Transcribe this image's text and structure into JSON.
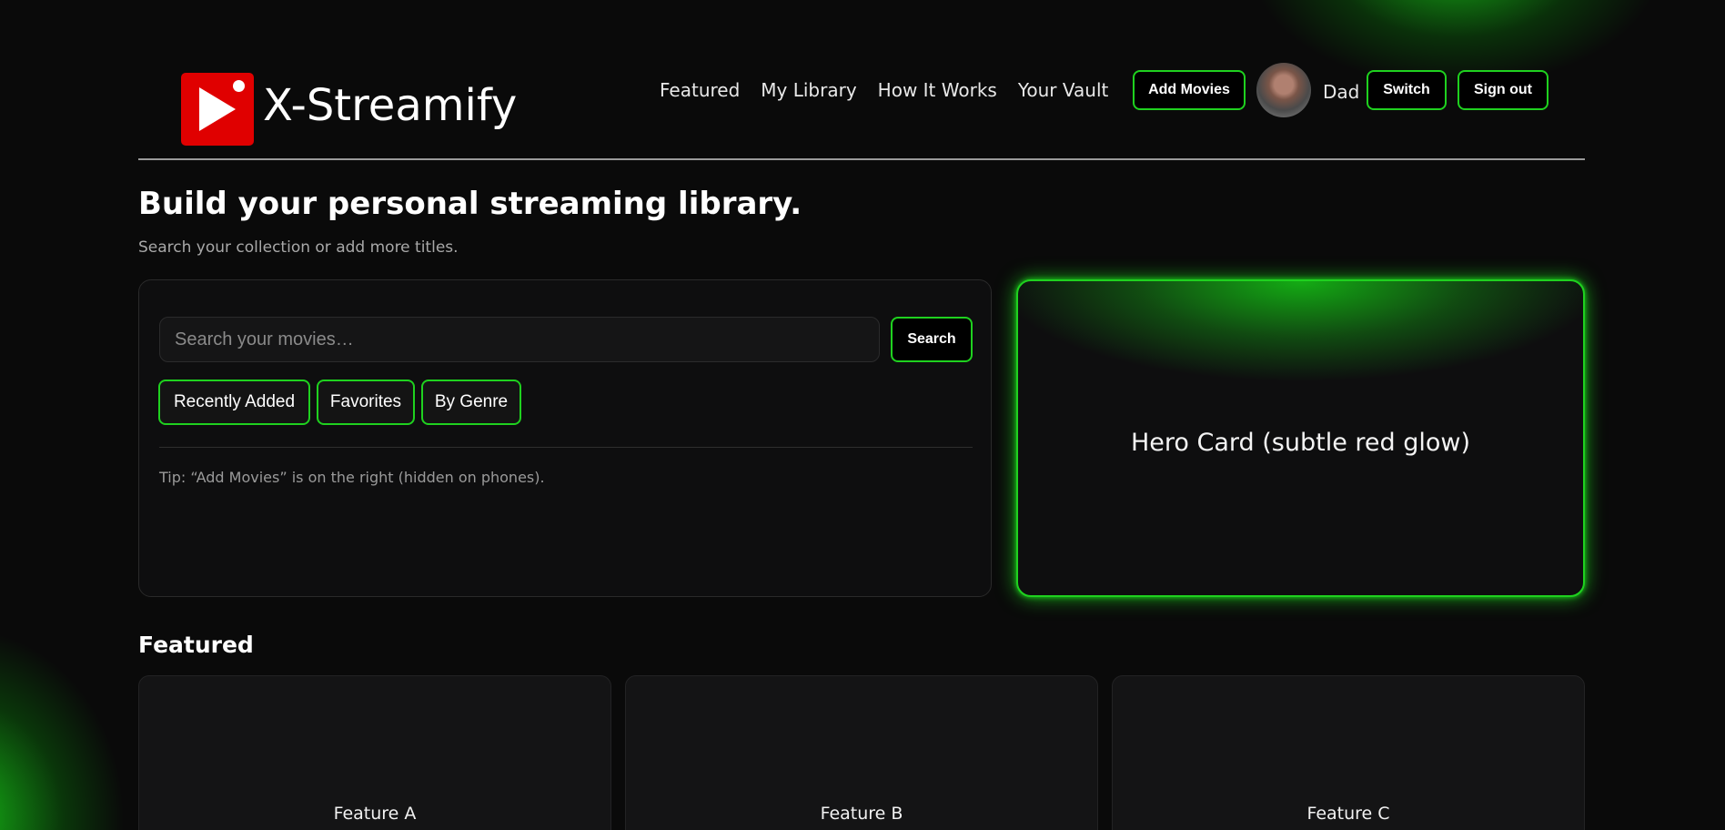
{
  "header": {
    "brand": "X-Streamify",
    "nav": [
      "Featured",
      "My Library",
      "How It Works",
      "Your Vault"
    ],
    "add_movies_label": "Add Movies",
    "user_name": "Dad",
    "switch_label": "Switch",
    "sign_out_label": "Sign out"
  },
  "intro": {
    "title": "Build your personal streaming library.",
    "subtitle": "Search your collection or add more titles."
  },
  "search": {
    "placeholder": "Search your movies…",
    "value": "",
    "button_label": "Search",
    "chips": [
      "Recently Added",
      "Favorites",
      "By Genre"
    ],
    "tip": "Tip: “Add Movies” is on the right (hidden on phones)."
  },
  "hero": {
    "label": "Hero Card (subtle red glow)"
  },
  "featured": {
    "heading": "Featured",
    "cards": [
      "Feature A",
      "Feature B",
      "Feature C"
    ]
  },
  "colors": {
    "accent": "#1fd11f",
    "brand_red": "#e00000",
    "background": "#0a0a0a"
  },
  "icons": {
    "logo": "play-icon"
  }
}
